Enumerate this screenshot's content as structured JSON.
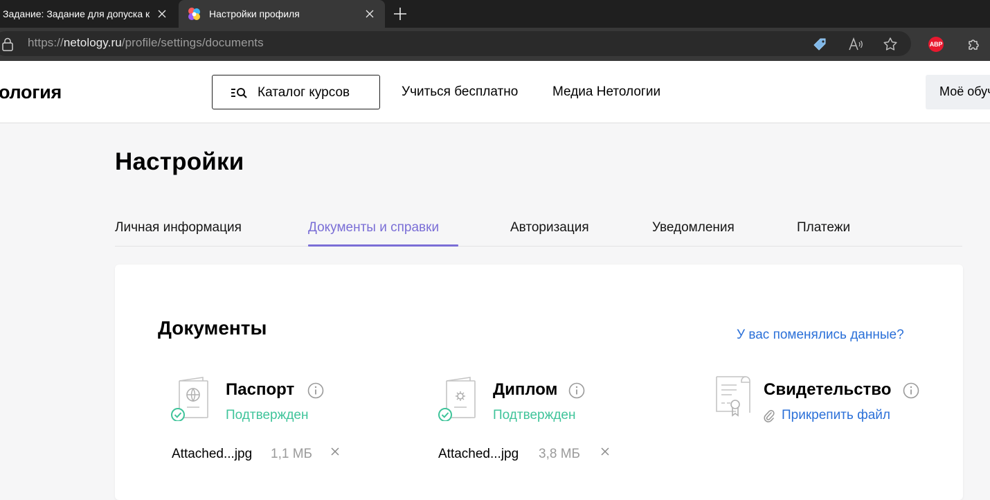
{
  "browser": {
    "tabs": [
      {
        "title": "Задание: Задание для допуска к"
      },
      {
        "title": "Настройки профиля"
      }
    ],
    "url_scheme": "https://",
    "url_host": "netology.ru",
    "url_path": "/profile/settings/documents",
    "abp_label": "ABP"
  },
  "header": {
    "logo": "ология",
    "catalog_button": "Каталог курсов",
    "nav": [
      "Учиться бесплатно",
      "Медиа Нетологии"
    ],
    "my_learning": "Моё обучение"
  },
  "page": {
    "title": "Настройки",
    "tabs": [
      {
        "label": "Личная информация"
      },
      {
        "label": "Документы и справки",
        "active": true
      },
      {
        "label": "Авторизация"
      },
      {
        "label": "Уведомления"
      },
      {
        "label": "Платежи"
      }
    ]
  },
  "documents": {
    "title": "Документы",
    "changed_link": "У вас поменялись данные?",
    "items": [
      {
        "name": "Паспорт",
        "status": "Подтвержден",
        "file_name": "Attached...jpg",
        "file_size": "1,1 МБ"
      },
      {
        "name": "Диплом",
        "status": "Подтвержден",
        "file_name": "Attached...jpg",
        "file_size": "3,8 МБ"
      },
      {
        "name": "Свидетельство",
        "attach_label": "Прикрепить файл"
      }
    ]
  },
  "colors": {
    "accent": "#7a6ed6",
    "link": "#2b70d8",
    "success": "#3fc49a",
    "abp": "#e8192f"
  }
}
